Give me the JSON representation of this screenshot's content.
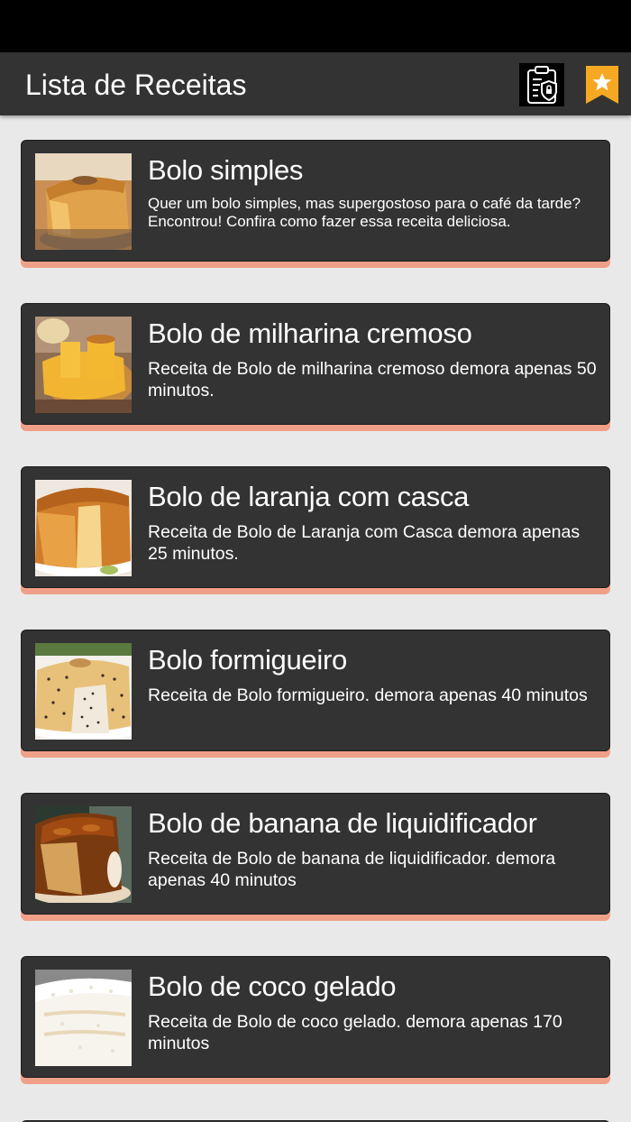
{
  "app_bar": {
    "title": "Lista de Receitas",
    "privacy_icon": "privacy-clipboard-lock-icon",
    "favorites_icon": "bookmark-star-icon",
    "accent_color": "#f7a823"
  },
  "recipes": [
    {
      "title": "Bolo simples",
      "description": "Quer um bolo simples, mas supergostoso para o café da tarde? Encontrou! Confira como fazer essa receita deliciosa.",
      "image": "bundt-cake-photo"
    },
    {
      "title": "Bolo de milharina cremoso",
      "description": "Receita de Bolo de milharina cremoso demora apenas 50 minutos.",
      "image": "corn-cake-photo"
    },
    {
      "title": "Bolo de laranja com casca",
      "description": "Receita de Bolo de Laranja com Casca demora apenas 25 minutos.",
      "image": "orange-cake-photo"
    },
    {
      "title": "Bolo formigueiro",
      "description": "Receita de Bolo formigueiro. demora apenas 40 minutos",
      "image": "sprinkle-cake-photo"
    },
    {
      "title": "Bolo de banana de liquidificador",
      "description": "Receita de Bolo de banana de liquidificador. demora apenas 40 minutos",
      "image": "banana-cake-photo"
    },
    {
      "title": "Bolo de coco gelado",
      "description": "Receita de Bolo de coco gelado. demora apenas 170 minutos",
      "image": "coconut-cake-photo"
    }
  ]
}
